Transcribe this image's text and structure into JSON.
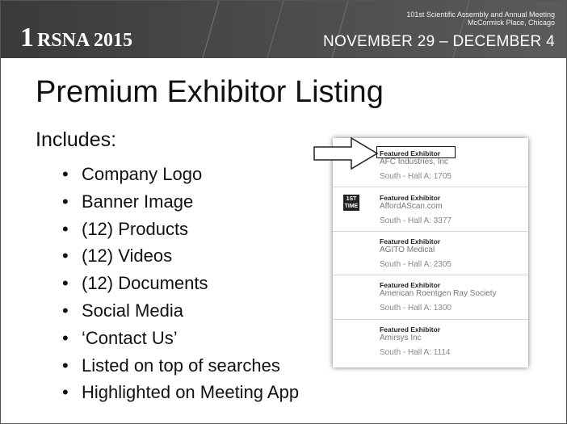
{
  "header": {
    "logo_text": "RSNA 2015",
    "meeting_line1": "101st Scientific Assembly and Annual Meeting",
    "meeting_line2": "McCormick Place, Chicago",
    "dates": "NOVEMBER 29 – DECEMBER 4"
  },
  "title": "Premium Exhibitor Listing",
  "includes_label": "Includes:",
  "bullets": [
    "Company Logo",
    "Banner Image",
    "(12) Products",
    "(12) Videos",
    "(12) Documents",
    "Social Media",
    "‘Contact Us’",
    "Listed on top of searches",
    "Highlighted on Meeting App"
  ],
  "screenshot": {
    "entries": [
      {
        "label": "Featured Exhibitor",
        "name": "AFC Industries, Inc",
        "location": "South - Hall A: 1705",
        "icon": ""
      },
      {
        "label": "Featured Exhibitor",
        "name": "AffordAScan.com",
        "location": "South - Hall A: 3377",
        "icon": "1ST TIME"
      },
      {
        "label": "Featured Exhibitor",
        "name": "AGITO Medical",
        "location": "South - Hall A: 2305",
        "icon": ""
      },
      {
        "label": "Featured Exhibitor",
        "name": "American Roentgen Ray Society",
        "location": "South - Hall A: 1300",
        "icon": ""
      },
      {
        "label": "Featured Exhibitor",
        "name": "Amirsys Inc",
        "location": "South - Hall A: 1114",
        "icon": ""
      }
    ]
  }
}
